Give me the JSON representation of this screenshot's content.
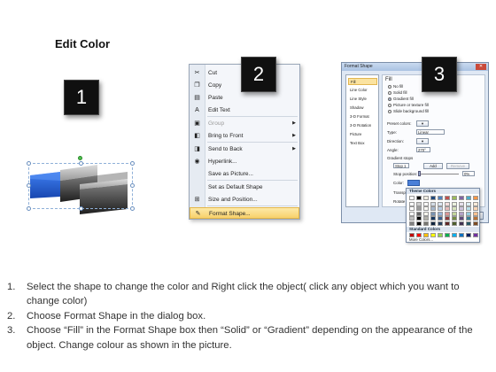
{
  "title": "Edit Color",
  "markers": [
    "1",
    "2",
    "3"
  ],
  "context_menu": {
    "items": [
      {
        "label": "Cut",
        "icon": "scissors-icon",
        "glyph": "✂",
        "disabled": false,
        "submenu": false
      },
      {
        "label": "Copy",
        "icon": "copy-icon",
        "glyph": "❐",
        "disabled": false,
        "submenu": false
      },
      {
        "label": "Paste",
        "icon": "paste-icon",
        "glyph": "▤",
        "disabled": false,
        "submenu": false
      },
      {
        "label": "Edit Text",
        "icon": "edit-text-icon",
        "glyph": "A",
        "disabled": false,
        "submenu": false
      },
      {
        "label": "Group",
        "icon": "group-icon",
        "glyph": "▣",
        "disabled": true,
        "submenu": true
      },
      {
        "label": "Bring to Front",
        "icon": "bring-front-icon",
        "glyph": "◧",
        "disabled": false,
        "submenu": true
      },
      {
        "label": "Send to Back",
        "icon": "send-back-icon",
        "glyph": "◨",
        "disabled": false,
        "submenu": true
      },
      {
        "label": "Hyperlink...",
        "icon": "hyperlink-icon",
        "glyph": "◉",
        "disabled": false,
        "submenu": false
      },
      {
        "label": "Save as Picture...",
        "icon": "",
        "glyph": "",
        "disabled": false,
        "submenu": false
      },
      {
        "label": "Set as Default Shape",
        "icon": "",
        "glyph": "",
        "disabled": false,
        "submenu": false
      },
      {
        "label": "Size and Position...",
        "icon": "size-position-icon",
        "glyph": "⊞",
        "disabled": false,
        "submenu": false
      },
      {
        "label": "Format Shape...",
        "icon": "format-shape-icon",
        "glyph": "✎",
        "disabled": false,
        "submenu": false,
        "highlight": true
      }
    ]
  },
  "format_dialog": {
    "title": "Format Shape",
    "nav": [
      "Fill",
      "Line Color",
      "Line Style",
      "Shadow",
      "3-D Format",
      "3-D Rotation",
      "Picture",
      "Text Box"
    ],
    "section_title": "Fill",
    "fill_options": [
      "No fill",
      "Solid fill",
      "Gradient fill",
      "Picture or texture fill",
      "Slide background fill"
    ],
    "preset_colors_label": "Preset colors:",
    "type_label": "Type:",
    "type_value": "Linear",
    "direction_label": "Direction:",
    "angle_label": "Angle:",
    "angle_value": "270°",
    "gradient_stops_label": "Gradient stops",
    "stop_value": "Stop 1",
    "add_label": "Add",
    "remove_label": "Remove",
    "stop_position_label": "Stop position:",
    "stop_position_value": "0%",
    "color_label": "Color:",
    "transparency_label": "Transpare",
    "rotate_label": "Rotate",
    "close_label": "Close",
    "theme_colors_label": "Theme Colors",
    "standard_colors_label": "Standard Colors",
    "more_colors_label": "More Colors..."
  },
  "colors": {
    "theme_top": [
      "#ffffff",
      "#000000",
      "#eeece1",
      "#1f497d",
      "#4f81bd",
      "#c0504d",
      "#9bbb59",
      "#8064a2",
      "#4bacc6",
      "#f79646"
    ],
    "standard": [
      "#c00000",
      "#ff0000",
      "#ffc000",
      "#ffff00",
      "#92d050",
      "#00b050",
      "#00b0f0",
      "#0070c0",
      "#002060",
      "#7030a0"
    ],
    "shape_blue": "#2a63d8"
  },
  "steps": [
    {
      "num": "1.",
      "text": "Select the shape to change the color and Right click the object( click any object which you want to change color)"
    },
    {
      "num": "2.",
      "text": "Choose Format Shape in the dialog box."
    },
    {
      "num": "3.",
      "text": "Choose “Fill” in the Format Shape box then “Solid” or “Gradient” depending on the appearance of the object. Change colour as shown in the picture."
    }
  ]
}
